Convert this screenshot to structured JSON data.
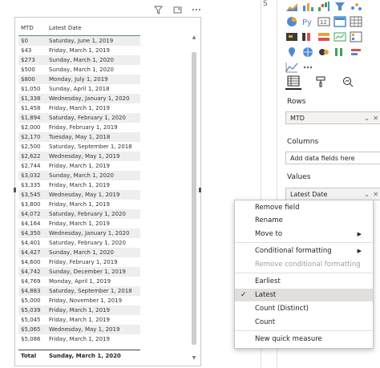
{
  "toolbar": {
    "icons": [
      "filter-icon",
      "focus-mode-icon",
      "more-options-icon"
    ]
  },
  "table": {
    "headers": [
      "MTD",
      "Latest Date"
    ],
    "rows": [
      [
        "$0",
        "Saturday, June 1, 2019"
      ],
      [
        "$43",
        "Friday, March 1, 2019"
      ],
      [
        "$273",
        "Sunday, March 1, 2020"
      ],
      [
        "$500",
        "Sunday, March 1, 2020"
      ],
      [
        "$800",
        "Monday, July 1, 2019"
      ],
      [
        "$1,050",
        "Sunday, April 1, 2018"
      ],
      [
        "$1,338",
        "Wednesday, January 1, 2020"
      ],
      [
        "$1,458",
        "Friday, March 1, 2019"
      ],
      [
        "$1,894",
        "Saturday, February 1, 2020"
      ],
      [
        "$2,000",
        "Friday, February 1, 2019"
      ],
      [
        "$2,170",
        "Tuesday, May 1, 2018"
      ],
      [
        "$2,500",
        "Saturday, September 1, 2018"
      ],
      [
        "$2,622",
        "Wednesday, May 1, 2019"
      ],
      [
        "$2,744",
        "Friday, March 1, 2019"
      ],
      [
        "$3,032",
        "Sunday, March 1, 2020"
      ],
      [
        "$3,335",
        "Friday, March 1, 2019"
      ],
      [
        "$3,545",
        "Wednesday, May 1, 2019"
      ],
      [
        "$3,800",
        "Friday, March 1, 2019"
      ],
      [
        "$4,072",
        "Saturday, February 1, 2020"
      ],
      [
        "$4,164",
        "Friday, March 1, 2019"
      ],
      [
        "$4,350",
        "Wednesday, January 1, 2020"
      ],
      [
        "$4,401",
        "Saturday, February 1, 2020"
      ],
      [
        "$4,427",
        "Sunday, March 1, 2020"
      ],
      [
        "$4,600",
        "Friday, February 1, 2019"
      ],
      [
        "$4,742",
        "Sunday, December 1, 2019"
      ],
      [
        "$4,769",
        "Monday, April 1, 2019"
      ],
      [
        "$4,883",
        "Saturday, September 1, 2018"
      ],
      [
        "$5,000",
        "Friday, November 1, 2019"
      ],
      [
        "$5,039",
        "Friday, March 1, 2019"
      ],
      [
        "$5,045",
        "Friday, March 1, 2019"
      ],
      [
        "$5,065",
        "Wednesday, May 1, 2019"
      ],
      [
        "$5,086",
        "Friday, March 1, 2019"
      ]
    ],
    "total_label": "Total",
    "total_value": "Sunday, March 1, 2020"
  },
  "pane": {
    "tab_letter": "S",
    "rows_label": "Rows",
    "rows_field": "MTD",
    "columns_label": "Columns",
    "columns_placeholder": "Add data fields here",
    "values_label": "Values",
    "values_field": "Latest Date"
  },
  "context_menu": {
    "items": [
      {
        "label": "Remove field"
      },
      {
        "label": "Rename"
      },
      {
        "label": "Move to"
      },
      {
        "label": "Conditional formatting"
      },
      {
        "label": "Remove conditional formatting"
      },
      {
        "label": "Earliest"
      },
      {
        "label": "Latest"
      },
      {
        "label": "Count (Distinct)"
      },
      {
        "label": "Count"
      },
      {
        "label": "New quick measure"
      }
    ],
    "selected": "Latest"
  },
  "colors": {
    "accent_teal": "#4e8f8c",
    "menu_selected": "#e1dfdd",
    "disabled_text": "#a19f9d"
  }
}
